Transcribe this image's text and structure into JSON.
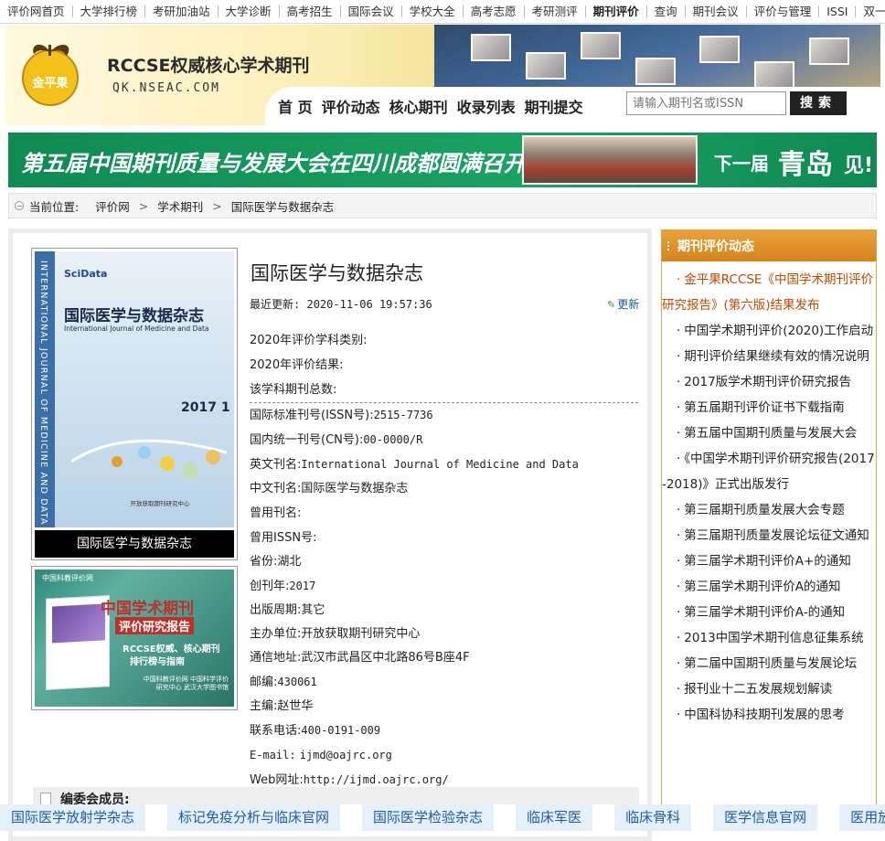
{
  "topnav": {
    "items": [
      "评价网首页",
      "大学排行榜",
      "考研加油站",
      "大学诊断",
      "高考招生",
      "国际会议",
      "学校大全",
      "高考志愿",
      "考研测评",
      "期刊评价",
      "查询",
      "期刊会议",
      "评价与管理",
      "ISSI",
      "双一流"
    ]
  },
  "header": {
    "logo_text": "金平果",
    "brand_title": "RCCSE权威核心学术期刊",
    "brand_url": "QK.NSEAC.COM",
    "nav": [
      "首 页",
      "评价动态",
      "核心期刊",
      "收录列表",
      "期刊提交"
    ],
    "search_placeholder": "请输入期刊名或ISSN",
    "search_button": "搜索"
  },
  "banner": {
    "text": "第五届中国期刊质量与发展大会在四川成都圆满召开!",
    "next_label": "下一届",
    "next_city": "青岛",
    "see": "见!"
  },
  "breadcrumb": {
    "label": "当前位置:",
    "items": [
      "评价网",
      "学术期刊",
      "国际医学与数据杂志"
    ]
  },
  "cover": {
    "side_text": "INTERNATIONAL JOURNAL OF MEDICINE AND DATA",
    "logo": "SciData",
    "title": "国际医学与数据杂志",
    "subtitle": "International Journal of Medicine and Data",
    "year": "2017 1",
    "publisher": "开放获取期刊研究中心",
    "caption": "国际医学与数据杂志"
  },
  "ad": {
    "head": "中国科教评价网",
    "title1": "中国学术期刊",
    "title2": "评价研究报告",
    "line1": "RCCSE权威、核心期刊",
    "line2": "排行榜与指南",
    "foot": "中国科教评价网 中国科学评价研究中心 武汉大学图书馆"
  },
  "journal": {
    "title": "国际医学与数据杂志",
    "updated_label": "最近更新:",
    "updated_value": "2020-11-06 19:57:36",
    "update_link": "更新",
    "rows": [
      {
        "label": "2020年评价学科类别:",
        "value": ""
      },
      {
        "label": "2020年评价结果:",
        "value": ""
      },
      {
        "label": "该学科期刊总数:",
        "value": ""
      },
      {
        "label": "国际标准刊号(ISSN号):",
        "value": "2515-7736"
      },
      {
        "label": "国内统一刊号(CN号):",
        "value": "00-0000/R"
      },
      {
        "label": "英文刊名:",
        "value": "International Journal of Medicine and Data"
      },
      {
        "label": "中文刊名:",
        "value": "国际医学与数据杂志"
      },
      {
        "label": "曾用刊名:",
        "value": ""
      },
      {
        "label": "曾用ISSN号:",
        "value": ""
      },
      {
        "label": "省份:",
        "value": "湖北"
      },
      {
        "label": "创刊年:",
        "value": "2017"
      },
      {
        "label": "出版周期:",
        "value": "其它"
      },
      {
        "label": "主办单位:",
        "value": "开放获取期刊研究中心"
      },
      {
        "label": "通信地址:",
        "value": "武汉市武昌区中北路86号B座4F"
      },
      {
        "label": "邮编:",
        "value": "430061"
      },
      {
        "label": "主编:",
        "value": "赵世华"
      },
      {
        "label": "联系电话:",
        "value": "400-0191-009"
      },
      {
        "label": "E-mail:",
        "value": "ijmd@oajrc.org"
      },
      {
        "label": "Web网址:",
        "value": "http://ijmd.oajrc.org/"
      }
    ],
    "editorial_label": "编委会成员:"
  },
  "sidebar": {
    "title": "期刊评价动态",
    "items": [
      "金平果RCCSE《中国学术期刊评价研究报告》(第六版)结果发布",
      "中国学术期刊评价(2020)工作启动",
      "期刊评价结果继续有效的情况说明",
      "2017版学术期刊评价研究报告",
      "第五届期刊评价证书下载指南",
      "第五届中国期刊质量与发展大会",
      "《中国学术期刊评价研究报告(2017-2018)》正式出版发行",
      "第三届期刊质量发展大会专题",
      "第三届期刊质量发展论坛征文通知",
      "第三届学术期刊评价A+的通知",
      "第三届学术期刊评价A的通知",
      "第三届学术期刊评价A-的通知",
      "2013中国学术期刊信息征集系统",
      "第二届中国期刊质量与发展论坛",
      "报刊业十二五发展规划解读",
      "中国科协科技期刊发展的思考"
    ]
  },
  "bottom_tags": [
    "国际医学放射学杂志",
    "标记免疫分析与临床官网",
    "国际医学检验杂志",
    "临床军医",
    "临床骨科",
    "医学信息官网",
    "医用放"
  ]
}
